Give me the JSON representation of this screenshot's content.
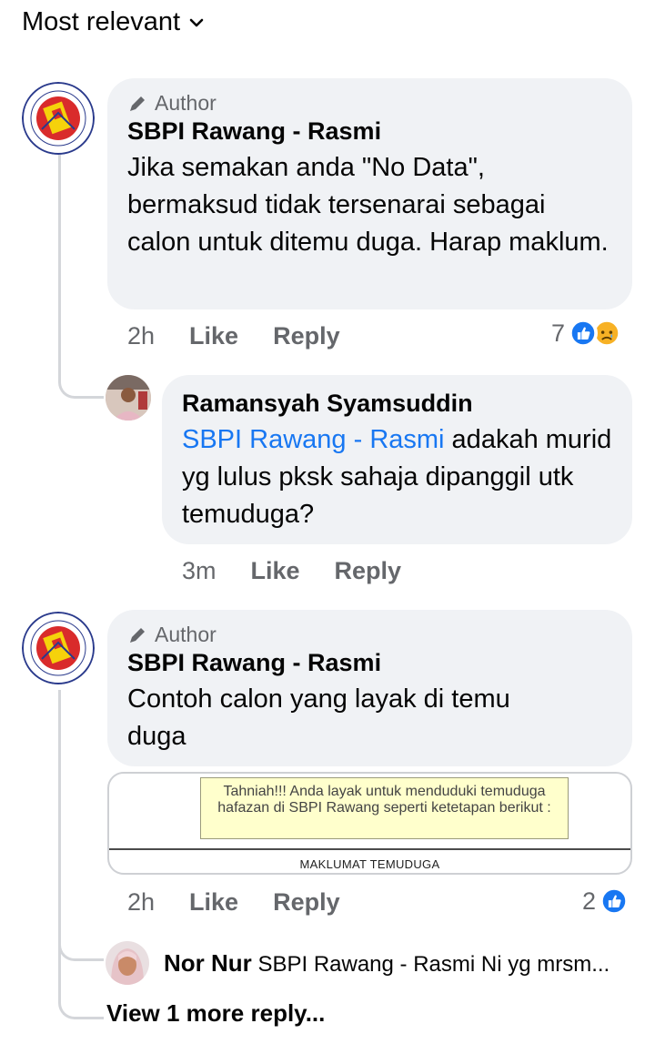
{
  "sort": {
    "label": "Most relevant"
  },
  "comments": [
    {
      "badge": "Author",
      "name": "SBPI Rawang - Rasmi",
      "text": "Jika semakan anda \"No Data\", bermaksud tidak tersenarai sebagai calon untuk ditemu duga. Harap maklum.",
      "time": "2h",
      "like": "Like",
      "reply": "Reply",
      "reaction_count": "7",
      "reactions": [
        "like-icon",
        "sad-icon"
      ]
    },
    {
      "name": "Ramansyah Syamsuddin",
      "mention": "SBPI Rawang - Rasmi",
      "text": " adakah murid yg lulus pksk sahaja dipanggil utk temuduga?",
      "time": "3m",
      "like": "Like",
      "reply": "Reply"
    },
    {
      "badge": "Author",
      "name": "SBPI Rawang - Rasmi",
      "text": "Contoh calon yang layak di temu duga",
      "attachment": {
        "notice": "Tahniah!!! Anda layak untuk menduduki temuduga hafazan di SBPI Rawang seperti ketetapan berikut :",
        "section": "MAKLUMAT TEMUDUGA"
      },
      "time": "2h",
      "like": "Like",
      "reply": "Reply",
      "reaction_count": "2",
      "reactions": [
        "like-icon"
      ]
    }
  ],
  "reply_preview": {
    "name": "Nor Nur",
    "text": "SBPI Rawang - Rasmi Ni yg mrsm..."
  },
  "view_more": "View 1 more reply...",
  "colors": {
    "bubble": "#f0f2f5",
    "link": "#1877f2",
    "muted": "#65676b",
    "like": "#1877f2",
    "sad": "#f7b125"
  }
}
